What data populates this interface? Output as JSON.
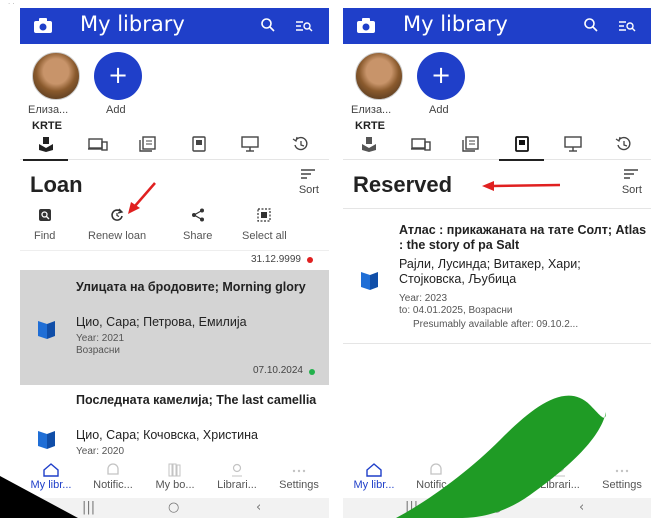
{
  "left": {
    "app_title": "My library",
    "account": {
      "name": "Елиза...",
      "add_label": "Add",
      "code": "KRTE"
    },
    "section_title": "Loan",
    "sort_label": "Sort",
    "actions": {
      "find": "Find",
      "renew": "Renew loan",
      "share": "Share",
      "select_all": "Select all"
    },
    "top_due_date": "31.12.9999",
    "cards": [
      {
        "title": "Улицата на бродовите; Morning glory",
        "authors": "Цио, Сара; Петрова, Емилија",
        "year": "Year: 2021",
        "audience": "Возрасни",
        "due": "07.10.2024"
      },
      {
        "title": "Последната камелија; The last camellia",
        "authors": "Цио, Сара; Кочовска, Христина",
        "year": "Year: 2020"
      }
    ],
    "nav": {
      "my_library": "My libr...",
      "notifications": "Notific...",
      "my_books": "My bo...",
      "libraries": "Librari...",
      "settings": "Settings"
    }
  },
  "right": {
    "app_title": "My library",
    "account": {
      "name": "Елиза...",
      "add_label": "Add",
      "code": "KRTE"
    },
    "section_title": "Reserved",
    "sort_label": "Sort",
    "card": {
      "title": "Атлас : прикажаната на тате Солт; Atlas : the story of pa Salt",
      "authors": "Рајли, Лусинда; Витакер, Хари; Стојковска, Љубица",
      "year": "Year: 2023",
      "to": "to: 04.01.2025, Возрасни",
      "available": "Presumably available after: 09.10.2..."
    },
    "nav": {
      "my_library": "My libr...",
      "notifications": "Notific...",
      "libraries": "Librari...",
      "settings": "Settings"
    }
  },
  "colors": {
    "brand": "#1f3fc9",
    "status_red": "#e02020",
    "status_green": "#22b14c",
    "arrow_red": "#e02020",
    "check_green": "#1f9b25"
  },
  "icons": [
    "camera-icon",
    "search-icon",
    "filter-icon",
    "plus-icon",
    "loan-tab-icon",
    "devices-tab-icon",
    "library-tab-icon",
    "reserved-tab-icon",
    "computer-tab-icon",
    "history-tab-icon",
    "sort-icon",
    "find-icon",
    "renew-icon",
    "share-icon",
    "select-all-icon",
    "book-icon",
    "home-icon",
    "bell-icon",
    "books-icon",
    "location-icon",
    "more-icon"
  ]
}
